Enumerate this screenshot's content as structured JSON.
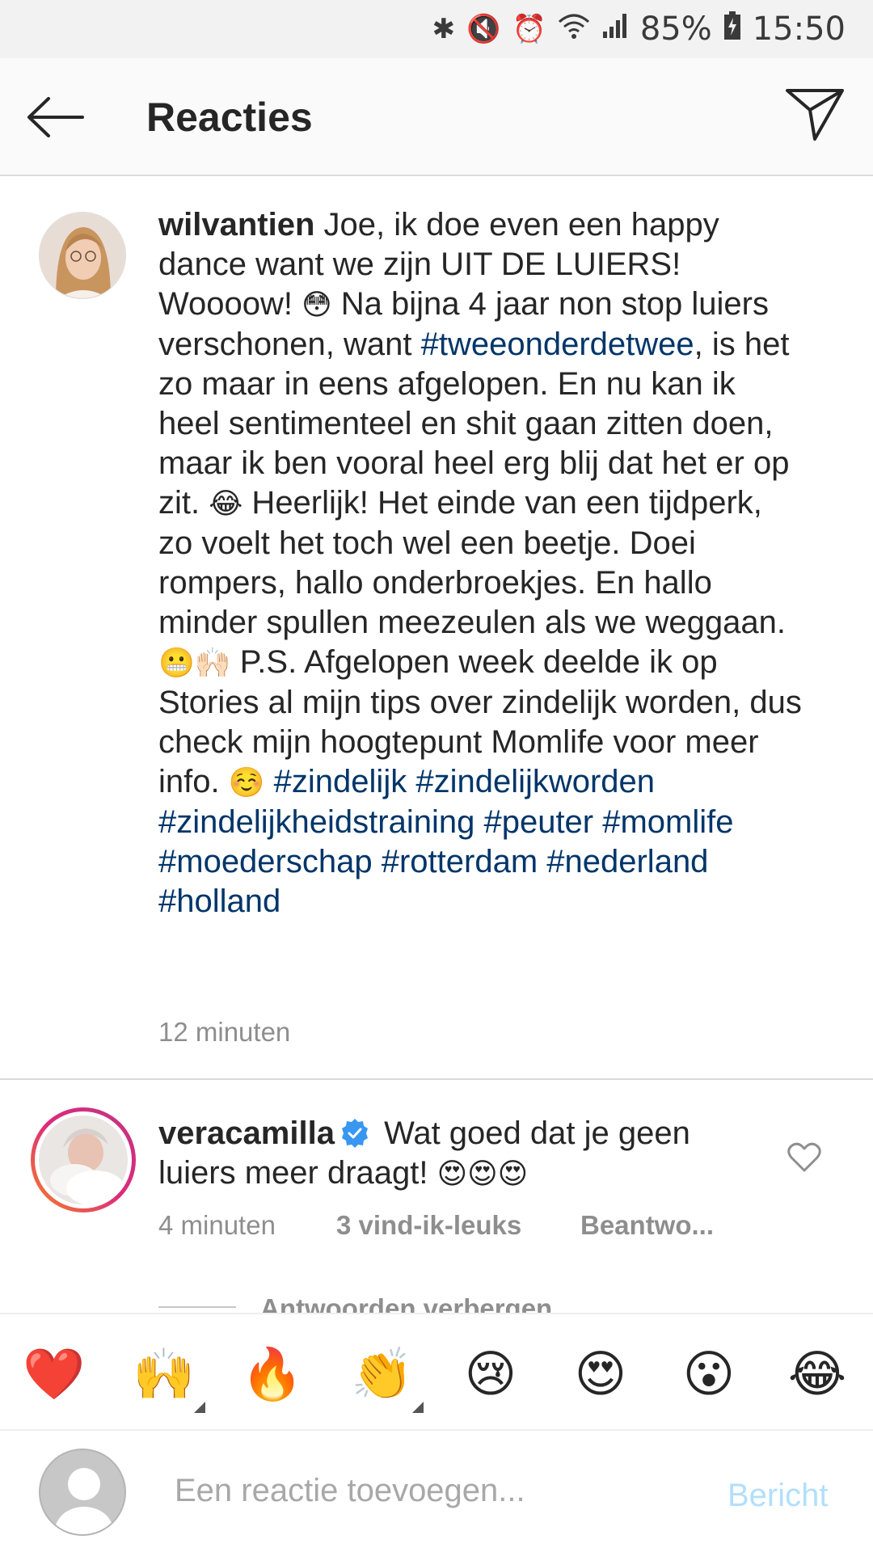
{
  "status_bar": {
    "battery": "85%",
    "time": "15:50",
    "icons": [
      "bluetooth-icon",
      "mute-icon",
      "alarm-icon",
      "wifi-icon",
      "signal-icon",
      "battery-icon"
    ]
  },
  "header": {
    "title": "Reacties",
    "icons": [
      "back-arrow-icon",
      "send-icon"
    ]
  },
  "caption": {
    "username": "wilvantien",
    "text_1": " Joe, ik doe even een happy dance want we zijn UIT DE LUIERS! Woooow! ",
    "emoji_1": "😳",
    "text_2": " Na bijna 4 jaar non stop luiers verschonen, want ",
    "hashtag_1": "#tweeonderdetwee",
    "text_3": ", is het zo maar in eens afgelopen. En nu kan ik heel sentimenteel en shit gaan zitten doen, maar ik ben vooral heel erg blij dat het er op zit. ",
    "emoji_2": "😂",
    "text_4": " Heerlijk! Het einde van een tijdperk, zo voelt het toch wel een beetje. Doei rompers, hallo onderbroekjes. En hallo minder spullen meezeulen als we weggaan. ",
    "emoji_3": "😬🙌🏻",
    "text_5": " P.S. Afgelopen week deelde ik op Stories al mijn tips over zindelijk worden, dus check mijn hoogtepunt Momlife voor meer info. ",
    "emoji_4": "☺️",
    "hashtags_2": "#zindelijk #zindelijkworden #zindelijkheidstraining #peuter #momlife #moederschap #rotterdam #nederland #holland",
    "time": "12 minuten"
  },
  "reply": {
    "username": "veracamilla",
    "text": " Wat goed dat je geen luiers meer draagt! ",
    "emoji": "😍😍😍",
    "time": "4 minuten",
    "likes": "3 vind-ik-leuks",
    "reply_action": "Beantwo...",
    "hide_replies": "Antwoorden verbergen"
  },
  "emoji_bar": [
    "❤️",
    "🙌",
    "🔥",
    "👏",
    "😢",
    "😍",
    "😮",
    "😂"
  ],
  "composer": {
    "placeholder": "Een reactie toevoegen...",
    "post_label": "Bericht"
  }
}
